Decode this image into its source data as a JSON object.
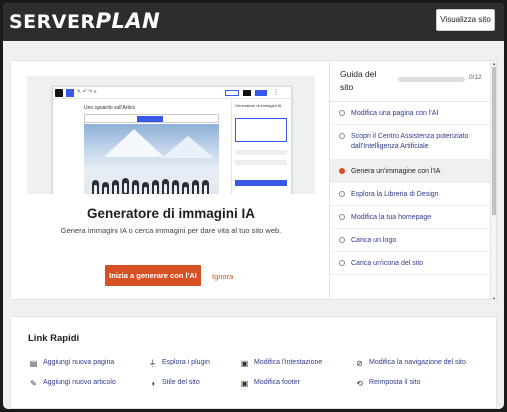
{
  "header": {
    "logo_part1": "SERVER",
    "logo_part2": "PLAN",
    "view_site_label": "Visualizza sito"
  },
  "feature": {
    "title": "Generatore di immagini IA",
    "description": "Genera immagini IA o cerca immagini per dare vita al tuo sito web.",
    "primary_button": "Inizia a generare con l'AI",
    "ignore_link": "Ignora",
    "preview": {
      "page_title": "Uno sguardo sull'Artico",
      "panel_title": "Generatore di immagini IA",
      "generate_label": "Genera immagini"
    }
  },
  "guide": {
    "title": "Guida del sito",
    "progress_text": "0/12",
    "progress_fraction": 0.0,
    "items": [
      {
        "label": "Modifica una pagina con l'AI",
        "active": false
      },
      {
        "label": "Scopri il Centro Assistenza potenziato dall'Intelligenza Artificiale",
        "active": false
      },
      {
        "label": "Genera un'immagine con l'IA",
        "active": true
      },
      {
        "label": "Esplora la Libreria di Design",
        "active": false
      },
      {
        "label": "Modifica la tua homepage",
        "active": false
      },
      {
        "label": "Carica un logo",
        "active": false
      },
      {
        "label": "Carica un'icona del sito",
        "active": false
      }
    ]
  },
  "quick_links": {
    "title": "Link Rapidi",
    "items": [
      {
        "label": "Aggiungi nuova pagina",
        "icon": "page-icon"
      },
      {
        "label": "Esplora i plugin",
        "icon": "plug-icon"
      },
      {
        "label": "Modifica l'intestazione",
        "icon": "header-layout-icon"
      },
      {
        "label": "Modifica la navigazione del sito",
        "icon": "compass-icon"
      },
      {
        "label": "Aggiungi nuovo articolo",
        "icon": "post-icon"
      },
      {
        "label": "Stile del sito",
        "icon": "half-circle-icon"
      },
      {
        "label": "Modifica footer",
        "icon": "footer-layout-icon"
      },
      {
        "label": "Reimposta il sito",
        "icon": "reset-icon"
      }
    ]
  },
  "colors": {
    "accent": "#d65023",
    "link": "#2f3b8a",
    "topbar": "#2d2d2d"
  }
}
